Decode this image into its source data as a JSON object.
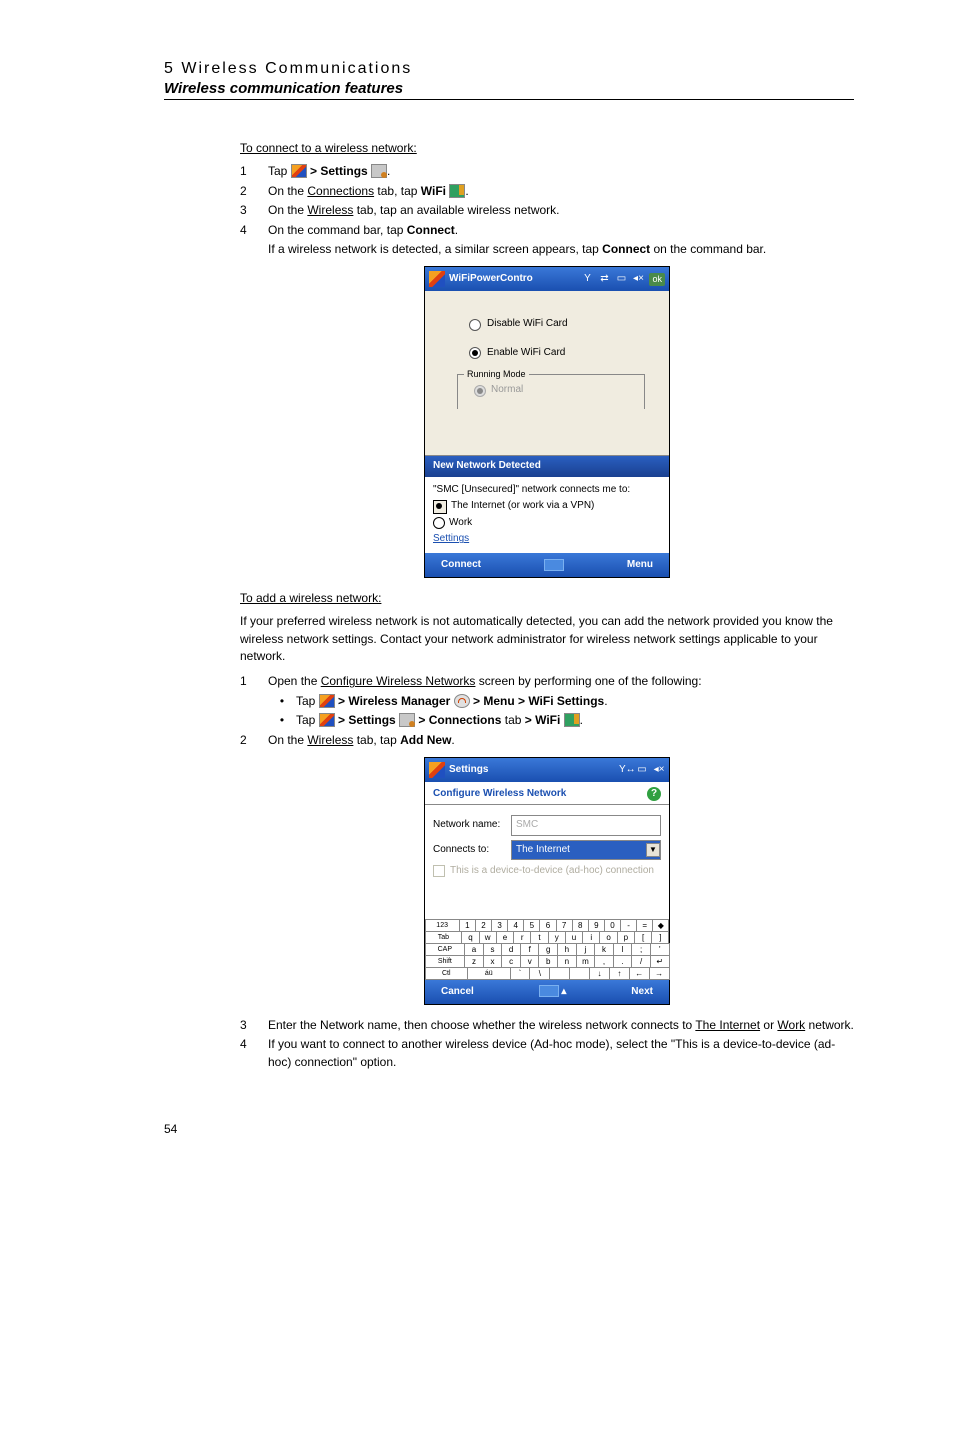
{
  "header": {
    "chapter": "5 Wireless Communications",
    "section": "Wireless communication features"
  },
  "connect": {
    "title": "To connect to a wireless network:",
    "step1_a": "Tap ",
    "step1_b": " > Settings ",
    "step1_c": ".",
    "step2_a": "On the ",
    "step2_u": "Connections",
    "step2_b": " tab, tap ",
    "step2_bold": "WiFi ",
    "step2_c": ".",
    "step3_a": "On the ",
    "step3_u": "Wireless",
    "step3_b": " tab, tap an available wireless network.",
    "step4_a": "On the command bar, tap ",
    "step4_bold": "Connect",
    "step4_b": ".",
    "step4_sub_a": "If a wireless network is detected, a similar screen appears, tap ",
    "step4_sub_bold": "Connect",
    "step4_sub_b": " on the command bar."
  },
  "shot1": {
    "title": "WiFiPowerContro",
    "opt_disable": "Disable WiFi Card",
    "opt_enable": "Enable WiFi Card",
    "running_mode": "Running Mode",
    "normal": "Normal",
    "popup_title": "New Network Detected",
    "popup_msg": "\"SMC [Unsecured]\" network connects me to:",
    "popup_opt1": "The Internet (or work via a VPN)",
    "popup_opt2": "Work",
    "settings_link": "Settings",
    "btn_connect": "Connect",
    "btn_menu": "Menu",
    "ok": "ok"
  },
  "add": {
    "title": "To add a wireless network:",
    "intro": "If your preferred wireless network is not automatically detected, you can add the network provided you know the wireless network settings. Contact your network administrator for wireless network settings applicable to your network.",
    "step1_a": "Open the ",
    "step1_u": "Configure Wireless Networks",
    "step1_b": " screen by performing one of the following:",
    "b1_a": "Tap ",
    "b1_b": " > Wireless Manager ",
    "b1_c": " > Menu > WiFi Settings",
    "b1_d": ".",
    "b2_a": "Tap ",
    "b2_b": " > Settings ",
    "b2_c": " > Connections ",
    "b2_d": "tab",
    "b2_e": " > WiFi ",
    "b2_f": ".",
    "step2_a": "On the ",
    "step2_u": "Wireless",
    "step2_b": " tab, tap ",
    "step2_bold": "Add New",
    "step2_c": "."
  },
  "shot2": {
    "title": "Settings",
    "config_title": "Configure Wireless Network",
    "lbl_name": "Network name:",
    "val_name": "SMC",
    "lbl_connects": "Connects to:",
    "val_connects": "The Internet",
    "checkbox_text": "This is a device-to-device (ad-hoc) connection",
    "btn_cancel": "Cancel",
    "btn_next": "Next"
  },
  "keyboard": {
    "r1": [
      "123",
      "1",
      "2",
      "3",
      "4",
      "5",
      "6",
      "7",
      "8",
      "9",
      "0",
      "-",
      "=",
      "◆"
    ],
    "r2": [
      "Tab",
      "q",
      "w",
      "e",
      "r",
      "t",
      "y",
      "u",
      "i",
      "o",
      "p",
      "[",
      "]"
    ],
    "r3": [
      "CAP",
      "a",
      "s",
      "d",
      "f",
      "g",
      "h",
      "j",
      "k",
      "l",
      ";",
      "'"
    ],
    "r4": [
      "Shift",
      "z",
      "x",
      "c",
      "v",
      "b",
      "n",
      "m",
      ",",
      ".",
      "/",
      "↵"
    ],
    "r5": [
      "Ctl",
      "áü",
      "`",
      "\\",
      " ",
      " ",
      "↓",
      "↑",
      "←",
      "→"
    ]
  },
  "tail": {
    "step3_a": "Enter the Network name, then choose whether the wireless network connects to ",
    "step3_u1": "The Internet",
    "step3_mid": " or ",
    "step3_u2": "Work",
    "step3_b": " network.",
    "step4": "If you want to connect to another wireless device (Ad-hoc mode), select the \"This is a device-to-device (ad-hoc) connection\" option."
  },
  "page_number": "54"
}
